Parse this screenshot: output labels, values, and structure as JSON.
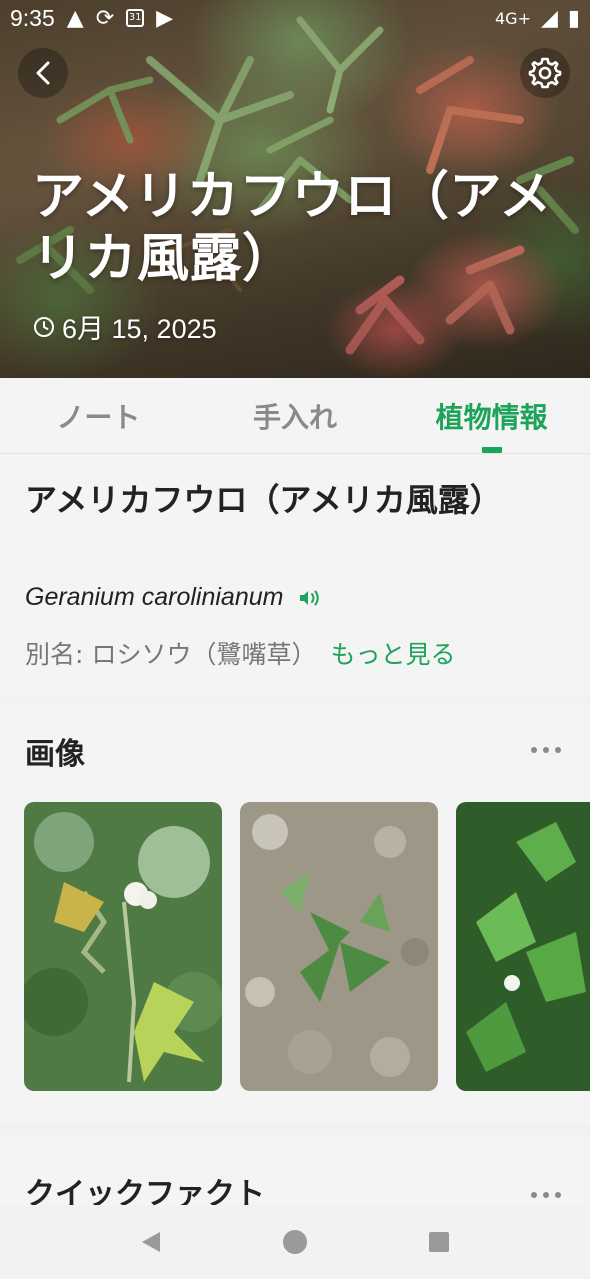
{
  "status_bar": {
    "time": "9:35",
    "calendar_day": "31",
    "network": "4G+",
    "icons": [
      "warning-icon",
      "sync-icon",
      "calendar-icon",
      "youtube-icon",
      "network-icon",
      "signal-icon",
      "battery-icon"
    ]
  },
  "header": {
    "title": "アメリカフウロ（アメリカ風露）",
    "date": "6月 15, 2025"
  },
  "tabs": [
    {
      "label": "ノート",
      "active": false
    },
    {
      "label": "手入れ",
      "active": false
    },
    {
      "label": "植物情報",
      "active": true
    }
  ],
  "plant": {
    "name": "アメリカフウロ（アメリカ風露）",
    "scientific_name": "Geranium carolinianum",
    "alias_label": "別名:",
    "alias_value": "ロシソウ（鷺嘴草）",
    "more_link": "もっと見る"
  },
  "images_section": {
    "title": "画像",
    "thumbnails": [
      "thumbnail-flower",
      "thumbnail-gravel",
      "thumbnail-leaves"
    ]
  },
  "quick_facts": {
    "title": "クイックファクト"
  },
  "colors": {
    "accent": "#1ea35a",
    "background": "#f4f4f4",
    "text": "#222222",
    "muted": "#777777"
  }
}
